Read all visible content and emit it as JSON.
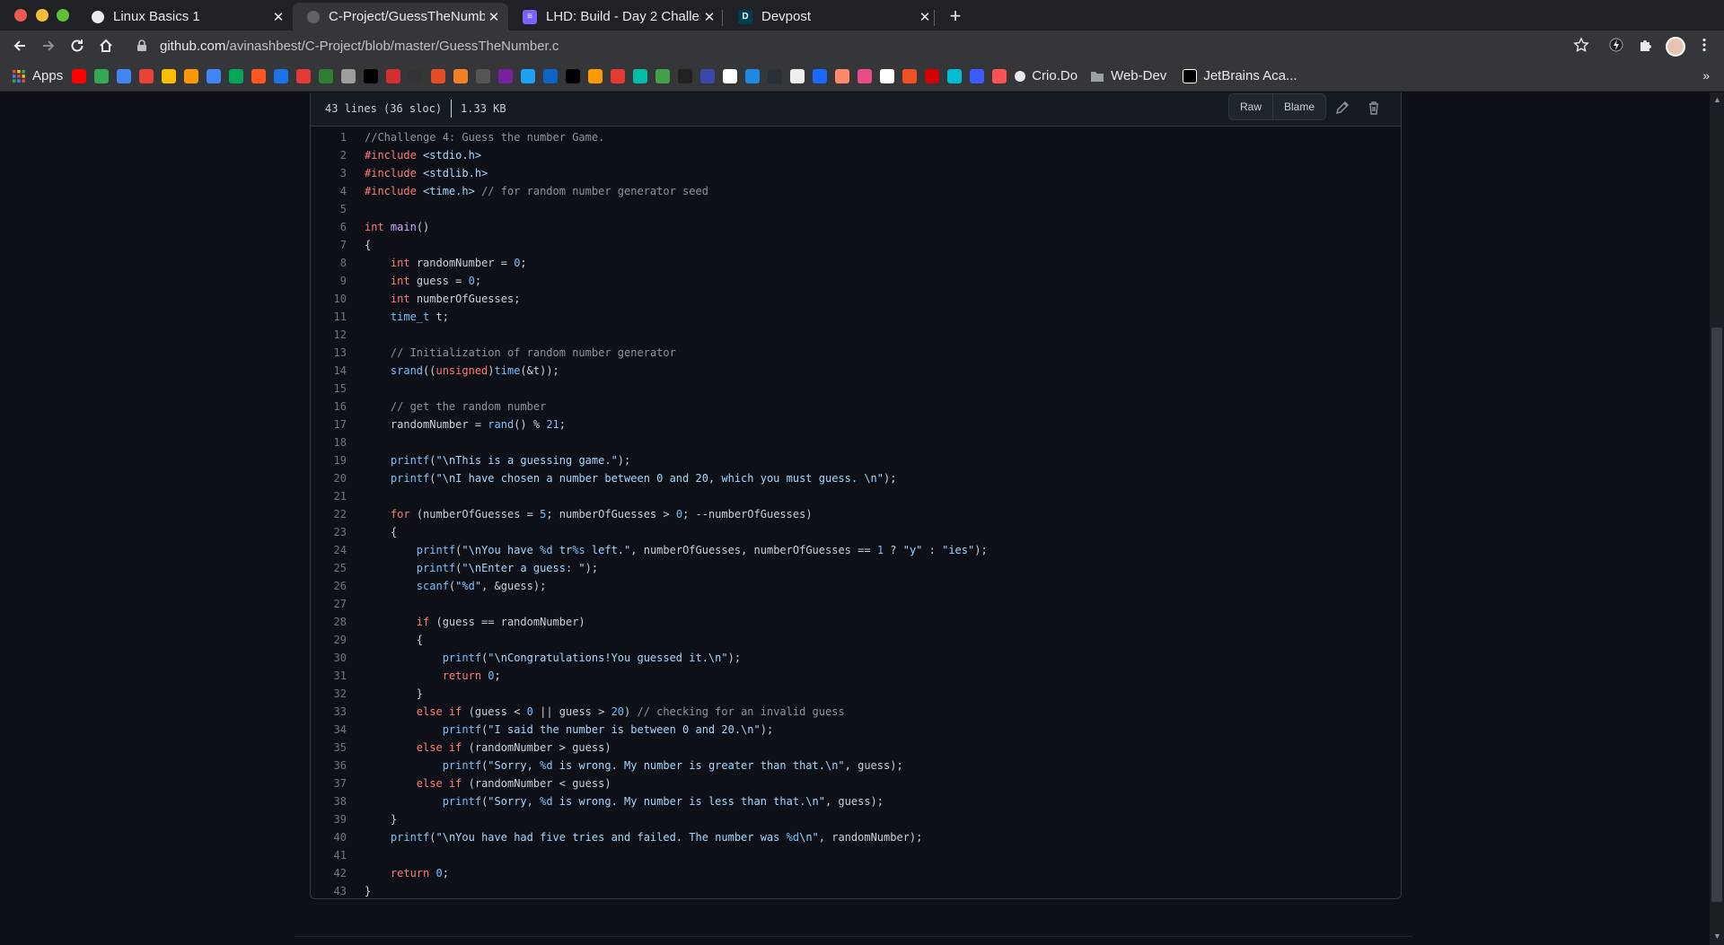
{
  "browser": {
    "tabs": [
      {
        "label": "Linux Basics 1",
        "icon": "linux-tab-icon",
        "active": false,
        "color": "#e8eaed"
      },
      {
        "label": "C-Project/GuessTheNumb",
        "icon": "github-tab-icon",
        "active": true,
        "color": "#5f6368"
      },
      {
        "label": "LHD: Build - Day 2 Challen",
        "icon": "lhd-tab-icon",
        "active": false,
        "color": "#7b61ff"
      },
      {
        "label": "Devpost",
        "icon": "devpost-tab-icon",
        "active": false,
        "color": "#003e54"
      }
    ],
    "url_host": "github.com",
    "url_path": "/avinashbest/C-Project/blob/master/GuessTheNumber.c",
    "bookmarks_named": {
      "apps": "Apps",
      "crio": "Crio.Do",
      "webdev": "Web-Dev",
      "jetbrains": "JetBrains Aca..."
    },
    "bookmark_icon_colors": [
      "#ff0000",
      "#34a853",
      "#4285f4",
      "#ea4335",
      "#fbbc04",
      "#ff9800",
      "#4285f4",
      "#00a859",
      "#ff5722",
      "#1a73e8",
      "#e53935",
      "#2e7d32",
      "#9e9e9e",
      "#000000",
      "#d32f2f",
      "#333333",
      "#e44d26",
      "#f48024",
      "#555555",
      "#7b1fa2",
      "#1da1f2",
      "#0a66c2",
      "#000000",
      "#ff9900",
      "#e53935",
      "#00bfa5",
      "#43a047",
      "#212121",
      "#3949ab",
      "#ffffff",
      "#1e88e5",
      "#263238",
      "#eeeeee",
      "#1769ff",
      "#ff8a65",
      "#ea4c89",
      "#ffffff",
      "#f25022",
      "#d50000",
      "#00bcd4",
      "#3d5afe",
      "#ff5252"
    ]
  },
  "file": {
    "lines_info": "43 lines (36 sloc)",
    "size": "1.33 KB",
    "raw_label": "Raw",
    "blame_label": "Blame"
  },
  "code_lines": [
    "//Challenge 4: Guess the number Game.",
    "#include <stdio.h>",
    "#include <stdlib.h>",
    "#include <time.h> // for random number generator seed",
    "",
    "int main()",
    "{",
    "    int randomNumber = 0;",
    "    int guess = 0;",
    "    int numberOfGuesses;",
    "    time_t t;",
    "",
    "    // Initialization of random number generator",
    "    srand((unsigned)time(&t));",
    "",
    "    // get the random number",
    "    randomNumber = rand() % 21;",
    "",
    "    printf(\"\\nThis is a guessing game.\");",
    "    printf(\"\\nI have chosen a number between 0 and 20, which you must guess. \\n\");",
    "",
    "    for (numberOfGuesses = 5; numberOfGuesses > 0; --numberOfGuesses)",
    "    {",
    "        printf(\"\\nYou have %d tr%s left.\", numberOfGuesses, numberOfGuesses == 1 ? \"y\" : \"ies\");",
    "        printf(\"\\nEnter a guess: \");",
    "        scanf(\"%d\", &guess);",
    "",
    "        if (guess == randomNumber)",
    "        {",
    "            printf(\"\\nCongratulations!You guessed it.\\n\");",
    "            return 0;",
    "        }",
    "        else if (guess < 0 || guess > 20) // checking for an invalid guess",
    "            printf(\"I said the number is between 0 and 20.\\n\");",
    "        else if (randomNumber > guess)",
    "            printf(\"Sorry, %d is wrong. My number is greater than that.\\n\", guess);",
    "        else if (randomNumber < guess)",
    "            printf(\"Sorry, %d is wrong. My number is less than that.\\n\", guess);",
    "    }",
    "    printf(\"\\nYou have had five tries and failed. The number was %d\\n\", randomNumber);",
    "",
    "    return 0;",
    "}"
  ]
}
